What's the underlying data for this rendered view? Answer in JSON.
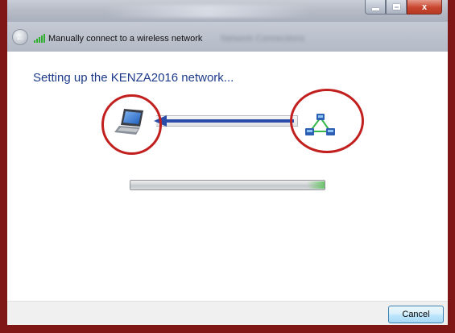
{
  "window": {
    "title": "Manually connect to a wireless network",
    "obscured_text": "Network Connections",
    "controls": {
      "minimize": "minimize",
      "maximize": "maximize",
      "close": "x"
    }
  },
  "header": {
    "back_icon": "back-arrow-icon",
    "wifi_icon": "wireless-signal-icon"
  },
  "main": {
    "heading": "Setting up the KENZA2016 network...",
    "left_icon": "laptop-icon",
    "right_icon": "network-icon",
    "connection_arrow": "left-arrow",
    "progress": {
      "value": 1.0,
      "state": "in-progress"
    }
  },
  "footer": {
    "cancel_label": "Cancel"
  },
  "colors": {
    "frame": "#7e1716",
    "heading": "#1e3b8a",
    "highlight_circle": "#c21f1f",
    "arrow": "#2b4ca8"
  }
}
